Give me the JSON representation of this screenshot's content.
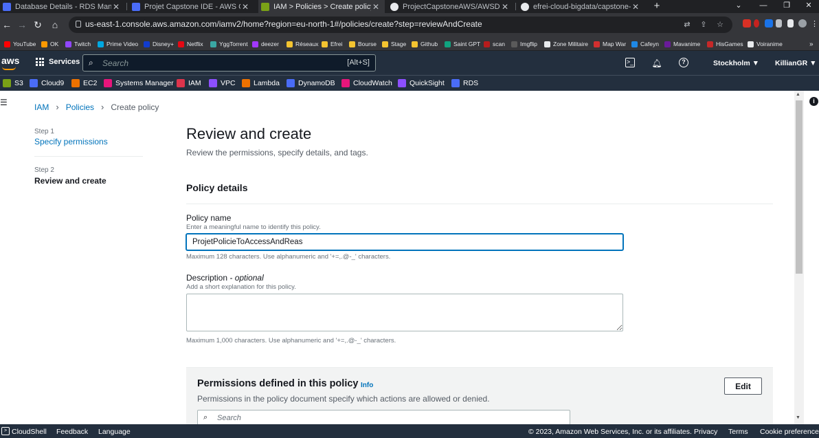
{
  "browser": {
    "tabs": [
      {
        "label": "Database Details - RDS Managem",
        "icon_color": "#4a6cf7",
        "active": false
      },
      {
        "label": "Projet Capstone IDE - AWS Clou",
        "icon_color": "#4a6cf7",
        "active": false
      },
      {
        "label": "IAM > Policies > Create policy",
        "icon_color": "#7aa116",
        "active": true
      },
      {
        "label": "ProjectCapstoneAWS/AWSDeplo",
        "icon_color": "#e8eaed",
        "active": false
      },
      {
        "label": "efrei-cloud-bigdata/capstone-pr",
        "icon_color": "#e8eaed",
        "active": false
      }
    ],
    "new_tab": "+",
    "url": "us-east-1.console.aws.amazon.com/iamv2/home?region=eu-north-1#/policies/create?step=reviewAndCreate",
    "bookmarks": [
      {
        "label": "YouTube",
        "color": "#ff0000"
      },
      {
        "label": "OK",
        "color": "#ff9900"
      },
      {
        "label": "Twitch",
        "color": "#9146ff"
      },
      {
        "label": "Prime Video",
        "color": "#00a8e1"
      },
      {
        "label": "Disney+",
        "color": "#113ccf"
      },
      {
        "label": "Netflix",
        "color": "#e50914"
      },
      {
        "label": "YggTorrent",
        "color": "#3aa7a3"
      },
      {
        "label": "deezer",
        "color": "#a238ff"
      },
      {
        "label": "Réseaux",
        "color": "#f4c430"
      },
      {
        "label": "Efrei",
        "color": "#f4c430"
      },
      {
        "label": "Bourse",
        "color": "#f4c430"
      },
      {
        "label": "Stage",
        "color": "#f4c430"
      },
      {
        "label": "Github",
        "color": "#f4c430"
      },
      {
        "label": "Saint GPT",
        "color": "#10a37f"
      },
      {
        "label": "scan",
        "color": "#b71c1c"
      },
      {
        "label": "Imgflip",
        "color": "#5a5a5a"
      },
      {
        "label": "Zone Militaire",
        "color": "#e8eaed"
      },
      {
        "label": "Map War",
        "color": "#d32f2f"
      },
      {
        "label": "Cafeyn",
        "color": "#1e88e5"
      },
      {
        "label": "Mavanime",
        "color": "#6a1b9a"
      },
      {
        "label": "HisGames",
        "color": "#c62828"
      },
      {
        "label": "Voiranime",
        "color": "#e8eaed"
      }
    ]
  },
  "aws_header": {
    "logo": "aws",
    "services_label": "Services",
    "search_placeholder": "Search",
    "search_shortcut": "[Alt+S]",
    "region": "Stockholm ▼",
    "user": "KillianGR ▼"
  },
  "favorites": [
    {
      "label": "S3",
      "color": "#7aa116"
    },
    {
      "label": "Cloud9",
      "color": "#4a6cf7"
    },
    {
      "label": "EC2",
      "color": "#ed7100"
    },
    {
      "label": "Systems Manager",
      "color": "#e7157b"
    },
    {
      "label": "IAM",
      "color": "#dd344c"
    },
    {
      "label": "VPC",
      "color": "#8c4fff"
    },
    {
      "label": "Lambda",
      "color": "#ed7100"
    },
    {
      "label": "DynamoDB",
      "color": "#4a6cf7"
    },
    {
      "label": "CloudWatch",
      "color": "#e7157b"
    },
    {
      "label": "QuickSight",
      "color": "#8c4fff"
    },
    {
      "label": "RDS",
      "color": "#4a6cf7"
    }
  ],
  "breadcrumb": {
    "iam": "IAM",
    "policies": "Policies",
    "current": "Create policy"
  },
  "steps": {
    "step1_label": "Step 1",
    "step1_title": "Specify permissions",
    "step2_label": "Step 2",
    "step2_title": "Review and create"
  },
  "main": {
    "title": "Review and create",
    "description": "Review the permissions, specify details, and tags.",
    "section_title": "Policy details",
    "policy_name_label": "Policy name",
    "policy_name_desc": "Enter a meaningful name to identify this policy.",
    "policy_name_value": "ProjetPolicieToAccessAndReas",
    "policy_name_hint": "Maximum 128 characters. Use alphanumeric and '+=,.@-_' characters.",
    "description_label": "Description",
    "description_optional": "- optional",
    "description_desc": "Add a short explanation for this policy.",
    "description_value": "",
    "description_hint": "Maximum 1,000 characters. Use alphanumeric and '+=,.@-_' characters."
  },
  "permissions": {
    "title": "Permissions defined in this policy",
    "info": "Info",
    "description": "Permissions in the policy document specify which actions are allowed or denied.",
    "edit_label": "Edit",
    "search_placeholder": "Search"
  },
  "footer": {
    "cloudshell": "CloudShell",
    "feedback": "Feedback",
    "language": "Language",
    "copyright": "© 2023, Amazon Web Services, Inc. or its affiliates.",
    "privacy": "Privacy",
    "terms": "Terms",
    "cookies": "Cookie preferences"
  }
}
